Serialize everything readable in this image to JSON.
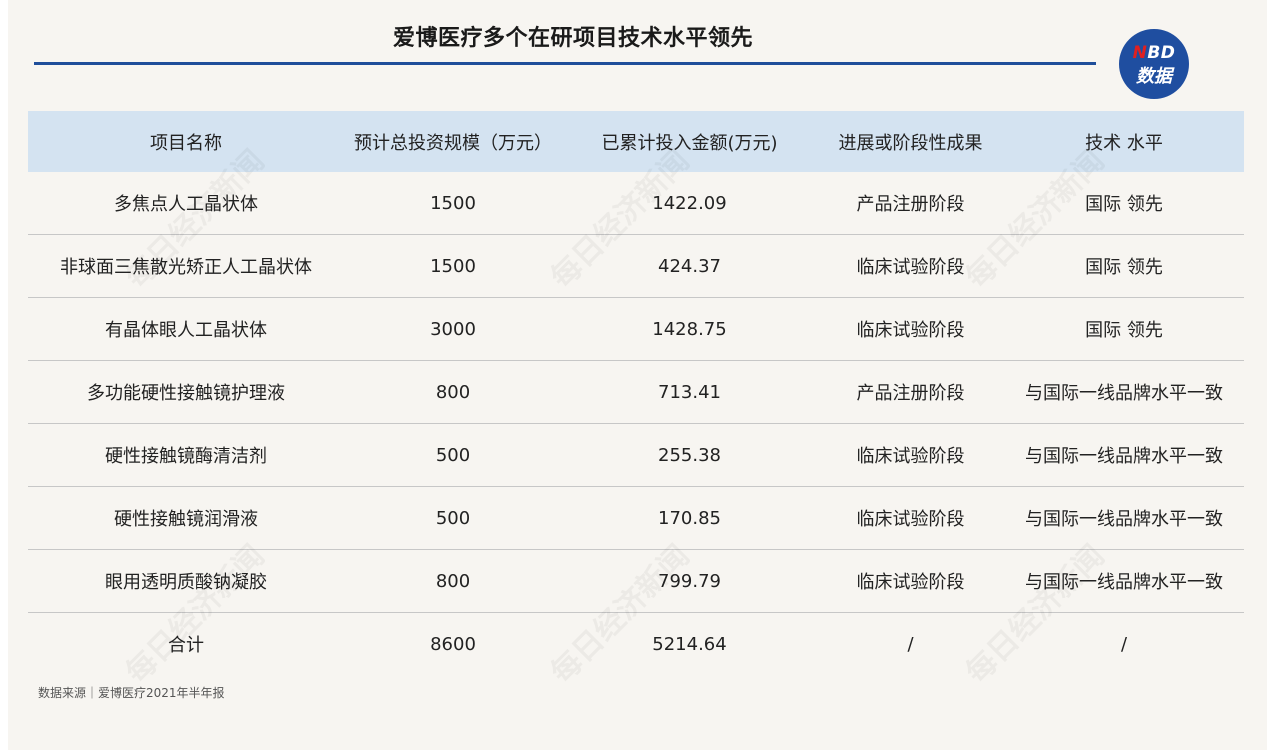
{
  "title": "爱博医疗多个在研项目技术水平领先",
  "logo": {
    "line1_n": "N",
    "line1_rest": "BD",
    "line2": "数据"
  },
  "watermark": "每日经济新闻",
  "source": "数据来源｜爱博医疗2021年半年报",
  "colors": {
    "header_bg": "#d4e3f1",
    "rule": "#1f4e9a",
    "background": "#f7f5f1"
  },
  "chart_data": {
    "type": "table",
    "title": "爱博医疗多个在研项目技术水平领先",
    "columns": [
      "项目名称",
      "预计总投资规模（万元）",
      "已累计投入金额(万元)",
      "进展或阶段性成果",
      "技术 水平"
    ],
    "rows": [
      [
        "多焦点人工晶状体",
        "1500",
        "1422.09",
        "产品注册阶段",
        "国际 领先"
      ],
      [
        "非球面三焦散光矫正人工晶状体",
        "1500",
        "424.37",
        "临床试验阶段",
        "国际 领先"
      ],
      [
        "有晶体眼人工晶状体",
        "3000",
        "1428.75",
        "临床试验阶段",
        "国际 领先"
      ],
      [
        "多功能硬性接触镜护理液",
        "800",
        "713.41",
        "产品注册阶段",
        "与国际一线品牌水平一致"
      ],
      [
        "硬性接触镜酶清洁剂",
        "500",
        "255.38",
        "临床试验阶段",
        "与国际一线品牌水平一致"
      ],
      [
        "硬性接触镜润滑液",
        "500",
        "170.85",
        "临床试验阶段",
        "与国际一线品牌水平一致"
      ],
      [
        "眼用透明质酸钠凝胶",
        "800",
        "799.79",
        "临床试验阶段",
        "与国际一线品牌水平一致"
      ],
      [
        "合计",
        "8600",
        "5214.64",
        "/",
        "/"
      ]
    ]
  }
}
